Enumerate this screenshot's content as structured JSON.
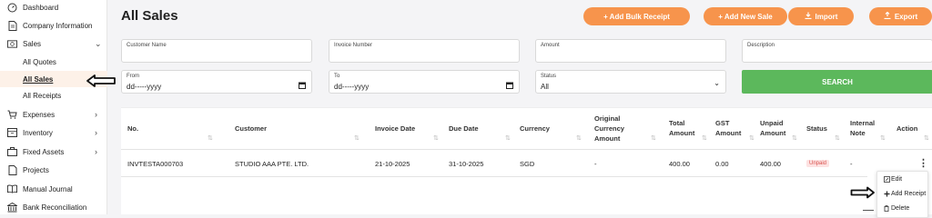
{
  "sidebar": {
    "items": [
      {
        "label": "Dashboard",
        "icon": "dashboard-icon"
      },
      {
        "label": "Company Information",
        "icon": "document-icon"
      },
      {
        "label": "Sales",
        "icon": "money-icon"
      },
      {
        "label": "Expenses",
        "icon": "cart-icon"
      },
      {
        "label": "Inventory",
        "icon": "box-icon"
      },
      {
        "label": "Fixed Assets",
        "icon": "asset-icon"
      },
      {
        "label": "Projects",
        "icon": "projects-icon"
      },
      {
        "label": "Manual Journal",
        "icon": "journal-icon"
      },
      {
        "label": "Bank Reconciliation",
        "icon": "bank-icon"
      }
    ],
    "sales_sub": {
      "all_quotes": "All Quotes",
      "all_sales": "All Sales",
      "all_receipts": "All Receipts"
    }
  },
  "header": {
    "title": "All Sales",
    "buttons": {
      "add_bulk_receipt": "+ Add Bulk Receipt",
      "add_new_sale": "+ Add New Sale",
      "import": "Import",
      "export": "Export"
    }
  },
  "filters": {
    "customer_name": {
      "label": "Customer Name",
      "value": ""
    },
    "invoice_number": {
      "label": "Invoice Number",
      "value": ""
    },
    "amount": {
      "label": "Amount",
      "value": ""
    },
    "description": {
      "label": "Description",
      "value": ""
    },
    "from": {
      "label": "From",
      "value": "dd-----yyyy"
    },
    "to": {
      "label": "To",
      "value": "dd-----yyyy"
    },
    "status": {
      "label": "Status",
      "value": "All"
    },
    "search_label": "SEARCH"
  },
  "table": {
    "headers": {
      "no": "No.",
      "customer": "Customer",
      "invoice_date": "Invoice Date",
      "due_date": "Due Date",
      "currency": "Currency",
      "original_currency_amount": [
        "Original",
        "Currency",
        "Amount"
      ],
      "total_amount": [
        "Total",
        "Amount"
      ],
      "gst_amount": [
        "GST",
        "Amount"
      ],
      "unpaid_amount": [
        "Unpaid",
        "Amount"
      ],
      "status": "Status",
      "internal_note": [
        "Internal",
        "Note"
      ],
      "action": "Action"
    },
    "rows": [
      {
        "no": "INVTESTA000703",
        "customer": "STUDIO AAA PTE. LTD.",
        "invoice_date": "21-10-2025",
        "due_date": "31-10-2025",
        "currency": "SGD",
        "original_currency_amount": "-",
        "total_amount": "400.00",
        "gst_amount": "0.00",
        "unpaid_amount": "400.00",
        "status": "Unpaid",
        "internal_note": "-"
      }
    ]
  },
  "action_menu": {
    "edit": "Edit",
    "add_receipt": "Add Receipt",
    "delete": "Delete"
  },
  "colors": {
    "accent": "#f7944c",
    "search": "#5cb85c",
    "unpaid_text": "#d9534f",
    "unpaid_bg": "#fde2e2"
  }
}
